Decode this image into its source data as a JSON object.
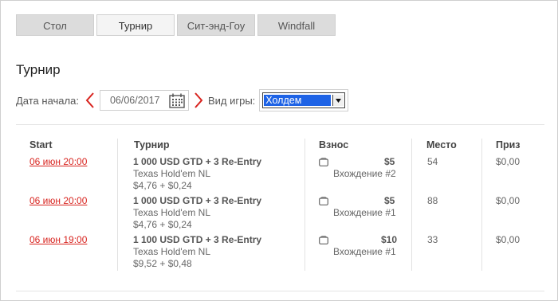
{
  "tabs": [
    {
      "label": "Стол",
      "active": false
    },
    {
      "label": "Турнир",
      "active": true
    },
    {
      "label": "Сит-энд-Гоу",
      "active": false
    },
    {
      "label": "Windfall",
      "active": false
    }
  ],
  "page_title": "Турнир",
  "filter": {
    "date_label": "Дата начала:",
    "date_value": "06/06/2017",
    "game_label": "Вид игры:",
    "game_value": "Холдем"
  },
  "table": {
    "headers": [
      "Start",
      "Турнир",
      "Взнос",
      "Место",
      "Приз"
    ],
    "rows": [
      {
        "start": "06 июн 20:00",
        "name": "1 000 USD GTD + 3 Re-Entry",
        "game": "Texas Hold'em NL",
        "buyin": "$4,76 + $0,24",
        "fee": "$5",
        "entry": "Вхождение #2",
        "place": "54",
        "prize": "$0,00"
      },
      {
        "start": "06 июн 20:00",
        "name": "1 000 USD GTD + 3 Re-Entry",
        "game": "Texas Hold'em NL",
        "buyin": "$4,76 + $0,24",
        "fee": "$5",
        "entry": "Вхождение #1",
        "place": "88",
        "prize": "$0,00"
      },
      {
        "start": "06 июн 19:00",
        "name": "1 100 USD GTD + 3 Re-Entry",
        "game": "Texas Hold'em NL",
        "buyin": "$9,52 + $0,48",
        "fee": "$10",
        "entry": "Вхождение #1",
        "place": "33",
        "prize": "$0,00"
      }
    ]
  },
  "colors": {
    "accent": "#d8241f",
    "select_highlight": "#1e63e6"
  },
  "icons": {
    "prev": "chevron-left-icon",
    "next": "chevron-right-icon",
    "calendar": "calendar-icon",
    "wallet": "wallet-icon"
  }
}
